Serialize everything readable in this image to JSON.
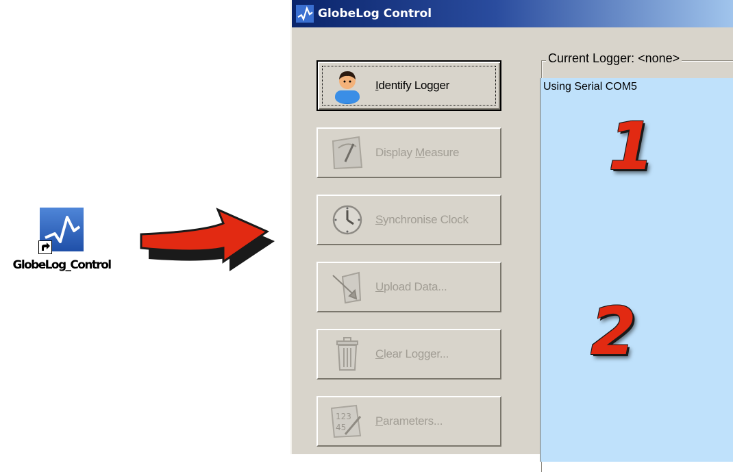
{
  "desktop": {
    "icon_label": "GlobeLog_Control",
    "icon": "globelog-app-icon"
  },
  "window": {
    "title": "GlobeLog Control",
    "buttons": [
      {
        "prefix": "",
        "mnemonic": "I",
        "rest": "dentify Logger",
        "icon": "person-icon",
        "enabled": true
      },
      {
        "prefix": "Display ",
        "mnemonic": "M",
        "rest": "easure",
        "icon": "gauge-icon",
        "enabled": false
      },
      {
        "prefix": "",
        "mnemonic": "S",
        "rest": "ynchronise Clock",
        "icon": "clock-icon",
        "enabled": false
      },
      {
        "prefix": "",
        "mnemonic": "U",
        "rest": "pload Data...",
        "icon": "upload-icon",
        "enabled": false
      },
      {
        "prefix": "",
        "mnemonic": "C",
        "rest": "lear Logger...",
        "icon": "trash-icon",
        "enabled": false
      },
      {
        "prefix": "",
        "mnemonic": "P",
        "rest": "arameters...",
        "icon": "parameters-icon",
        "enabled": false
      }
    ],
    "group_label": "Current Logger: <none>",
    "log_lines": [
      "Using Serial COM5"
    ]
  },
  "callouts": {
    "step1": "1",
    "step2": "2"
  },
  "colors": {
    "list_bg": "#bfe1fb",
    "callout_red": "#e22a12",
    "titlebar": "#0a246a"
  }
}
